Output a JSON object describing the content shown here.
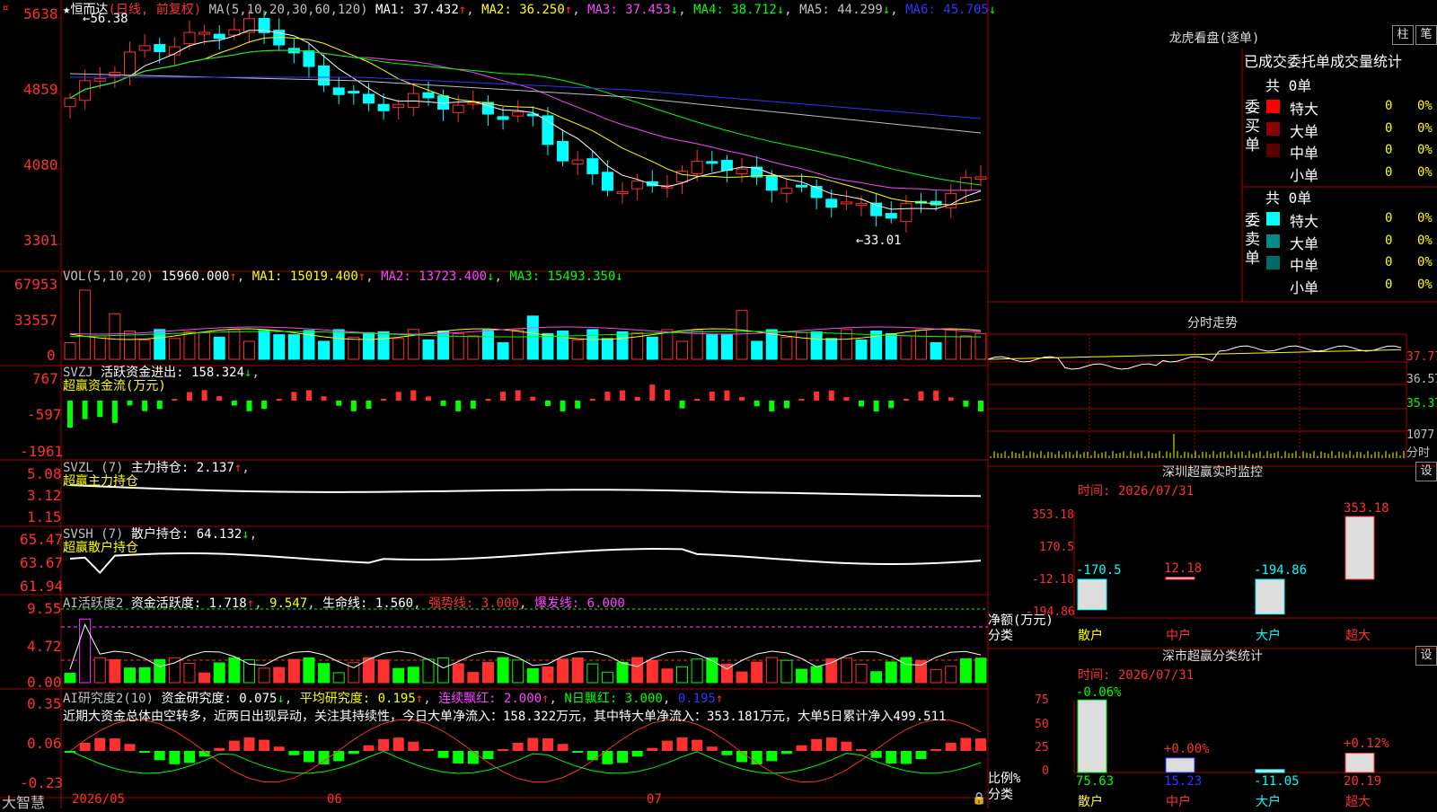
{
  "colors": {
    "up": "#ff3030",
    "down": "#00ffff",
    "bg": "#000000",
    "grid": "#aa0000",
    "ma1": "#ffffff",
    "ma2": "#ffff00",
    "ma3": "#ff44ff",
    "ma4": "#00ff00",
    "ma5": "#c0c0c0",
    "ma6": "#3333ff",
    "vma2": "#ff44ff",
    "vma3": "#00ff00",
    "sell": "#00ffff"
  },
  "logo_icon": "star-icon",
  "main": {
    "title": "恒而达",
    "period": "(日线, 前复权)",
    "ma_params": "MA(5,10,20,30,60,120)",
    "ma1": "MA1: 37.432",
    "ma1_arrow": "↑",
    "ma2": "MA2: 36.250",
    "ma2_arrow": "↑",
    "ma3": "MA3: 37.453",
    "ma3_arrow": "↓",
    "ma4": "MA4: 38.712",
    "ma4_arrow": "↓",
    "ma5": "MA5: 44.299",
    "ma5_arrow": "↓",
    "ma6": "MA6: 45.705",
    "ma6_arrow": "↓",
    "yaxis": [
      "5638",
      "4859",
      "4080",
      "3301"
    ],
    "high_label": "56.38",
    "low_label": "33.01",
    "corner": "¤"
  },
  "vol": {
    "label": "VOL(5,10,20)",
    "value": "15960.000",
    "value_arrow": "↑",
    "ma1": "MA1: 15019.400",
    "ma1_arrow": "↑",
    "ma2": "MA2: 13723.400",
    "ma2_arrow": "↓",
    "ma3": "MA3: 15493.350",
    "ma3_arrow": "↓",
    "yaxis": [
      "67953",
      "33557",
      "0"
    ]
  },
  "svzj": {
    "label": "SVZJ",
    "name": "活跃资金进出: 158.324",
    "arrow": "↓",
    "sub": "超赢资金流(万元)",
    "yaxis": [
      "767",
      "-597",
      "-1961"
    ]
  },
  "svzl": {
    "label": "SVZL (7)",
    "name": "主力持仓: 2.137",
    "arrow": "↑",
    "sub": "超赢主力持仓",
    "yaxis": [
      "5.08",
      "3.12",
      "1.15"
    ]
  },
  "svsh": {
    "label": "SVSH (7)",
    "name": "散户持仓: 64.132",
    "arrow": "↓",
    "sub": "超赢散户持仓",
    "yaxis": [
      "65.47",
      "63.67",
      "61.94"
    ]
  },
  "ai1": {
    "label": "AI活跃度2",
    "v1": "资金活跃度: 1.718",
    "v1_arrow": "↑",
    "v2": "9.547",
    "v3": "生命线: 1.560",
    "v4": "强势线: 3.000",
    "v5": "爆发线: 6.000",
    "yaxis": [
      "9.55",
      "4.72",
      "0.00"
    ]
  },
  "ai2": {
    "label": "AI研究度2(10)",
    "v1": "资金研究度: 0.075",
    "v1_arrow": "↓",
    "v2": "平均研究度: 0.195",
    "v2_arrow": "↑",
    "v3": "连续飘红: 2.000",
    "v3_arrow": "↑",
    "v4": "N日飘红: 3.000",
    "v5": "0.195",
    "v5_arrow": "↑",
    "comment": "近期大资金总体由空转多，近两日出现异动，关注其持续性，今日大单净流入：158.322万元，其中特大单净流入：353.181万元，大单5日累计净入499.511",
    "yaxis": [
      "0.35",
      "0.06",
      "-0.23"
    ]
  },
  "xaxis": {
    "brand": "大智慧",
    "labels": [
      "2026/05",
      "06",
      "07"
    ]
  },
  "dragon": {
    "title": "龙虎看盘(逐单)",
    "btn1": "柱",
    "btn2": "笔",
    "subtitle": "已成交委托单成交量统计",
    "buy_label": "委买单",
    "buy_total": "共 0单",
    "buy_rows": [
      {
        "name": "特大",
        "v": "0",
        "p": "0%",
        "color": "#ff0000"
      },
      {
        "name": "大单",
        "v": "0",
        "p": "0%",
        "color": "#8b0000"
      },
      {
        "name": "中单",
        "v": "0",
        "p": "0%",
        "color": "#5a0000"
      },
      {
        "name": "小单",
        "v": "0",
        "p": "0%",
        "color": "#000000"
      }
    ],
    "sell_label": "委卖单",
    "sell_total": "共 0单",
    "sell_rows": [
      {
        "name": "特大",
        "v": "0",
        "p": "0%",
        "color": "#00ffff"
      },
      {
        "name": "大单",
        "v": "0",
        "p": "0%",
        "color": "#008b8b"
      },
      {
        "name": "中单",
        "v": "0",
        "p": "0%",
        "color": "#006a6a"
      },
      {
        "name": "小单",
        "v": "0",
        "p": "0%",
        "color": "#000000"
      }
    ]
  },
  "fenshi": {
    "title": "分时走势",
    "yaxis": [
      "37.77",
      "36.57",
      "35.37"
    ],
    "vol_label": "1077",
    "unit": "分时"
  },
  "sz_monitor": {
    "title": "深圳超赢实时监控",
    "btn": "设",
    "time": "时间: 2026/07/31",
    "yaxis": [
      "353.18",
      "170.5",
      "-12.18",
      "-194.86"
    ],
    "ylabel": "净额(万元)",
    "xlabel": "分类",
    "cats": [
      "散户",
      "中户",
      "大户",
      "超大"
    ],
    "values": [
      -170.5,
      12.18,
      -194.86,
      353.18
    ],
    "value_labels": [
      "-170.5",
      "12.18",
      "-194.86",
      "353.18"
    ]
  },
  "sz_stats": {
    "title": "深市超赢分类统计",
    "btn": "设",
    "time": "时间: 2026/07/31",
    "yaxis": [
      "75",
      "50",
      "25",
      "0"
    ],
    "ylabel": "比例%",
    "xlabel": "分类",
    "cats": [
      "散户",
      "中户",
      "大户",
      "超大"
    ],
    "values": [
      75.63,
      15.23,
      -11.05,
      20.19
    ],
    "value_labels": [
      "75.63",
      "15.23",
      "-11.05",
      "20.19"
    ],
    "change_labels": [
      "-0.06%",
      "+0.00%",
      "",
      "+0.12%"
    ]
  }
}
